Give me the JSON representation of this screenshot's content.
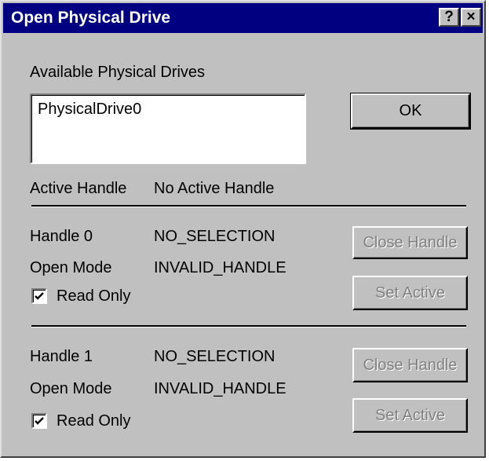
{
  "window": {
    "title": "Open Physical Drive",
    "help_button": "?",
    "close_button": "×"
  },
  "drives": {
    "label": "Available Physical Drives",
    "items": [
      "PhysicalDrive0"
    ]
  },
  "ok_button": "OK",
  "active_handle": {
    "label": "Active Handle",
    "value": "No Active Handle"
  },
  "handle0": {
    "label": "Handle 0",
    "value": "NO_SELECTION",
    "mode_label": "Open Mode",
    "mode_value": "INVALID_HANDLE",
    "readonly_label": "Read Only",
    "readonly_checked": true,
    "close_button": "Close Handle",
    "set_active_button": "Set Active"
  },
  "handle1": {
    "label": "Handle 1",
    "value": "NO_SELECTION",
    "mode_label": "Open Mode",
    "mode_value": "INVALID_HANDLE",
    "readonly_label": "Read Only",
    "readonly_checked": true,
    "close_button": "Close Handle",
    "set_active_button": "Set Active"
  }
}
